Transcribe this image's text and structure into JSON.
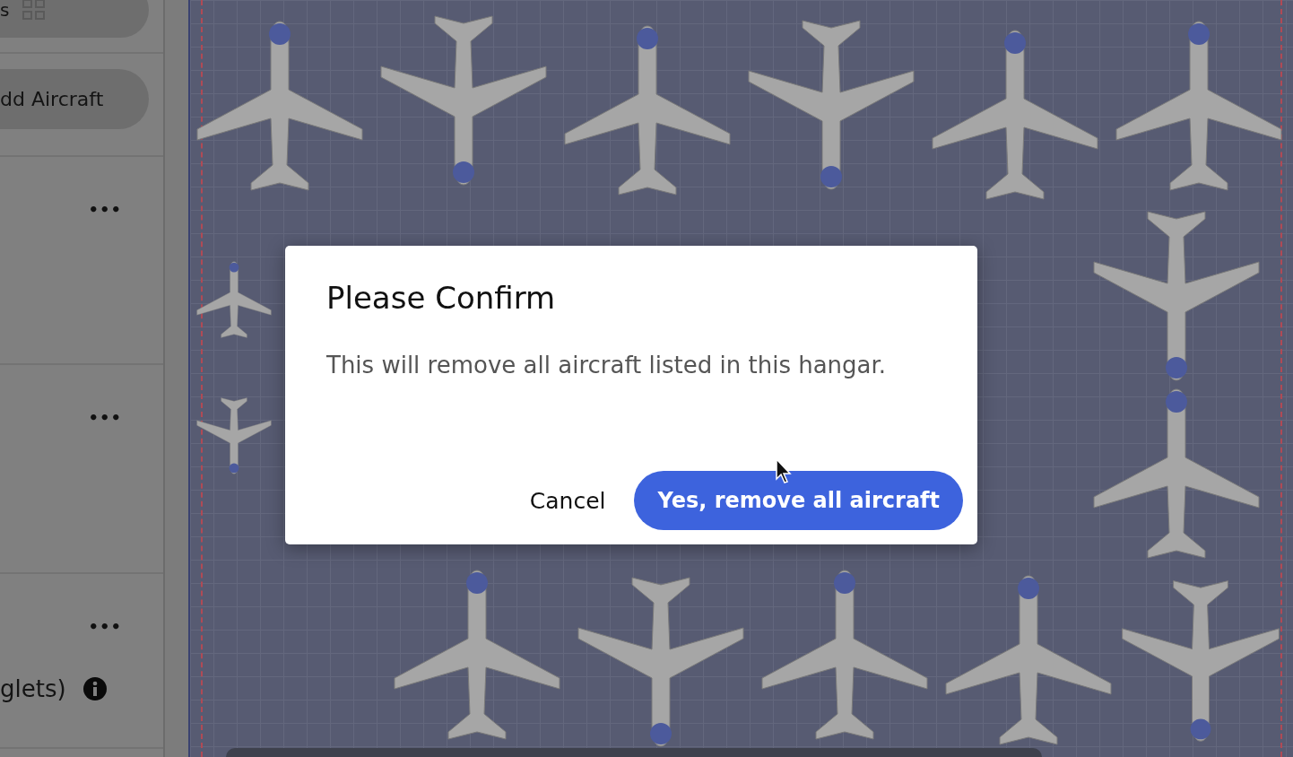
{
  "sidebar": {
    "view_label": "s",
    "add_button": "dd Aircraft",
    "rows": [
      {
        "menu": "•••"
      },
      {
        "menu": "•••"
      },
      {
        "menu": "•••",
        "note": "glets)"
      }
    ]
  },
  "dialog": {
    "title": "Please Confirm",
    "message": "This will remove all aircraft listed in this hangar.",
    "buttons": [
      {
        "label": "Cancel",
        "kind": "text"
      },
      {
        "label": "Yes, remove all aircraft",
        "kind": "primary"
      }
    ]
  }
}
